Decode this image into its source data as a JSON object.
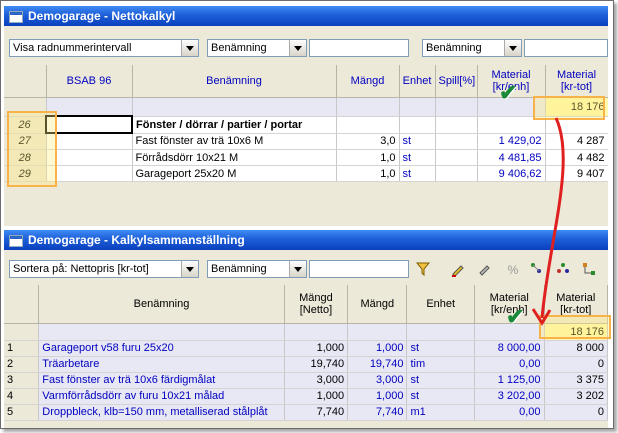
{
  "window1": {
    "title": "Demogarage - Nettokalkyl",
    "toolbar": {
      "filter": "Visa radnummerintervall",
      "sort1": "Benämning",
      "search1": "",
      "sort2": "Benämning",
      "search2": ""
    },
    "columns": {
      "bsab": "BSAB 96",
      "name": "Benämning",
      "qty": "Mängd",
      "unit": "Enhet",
      "waste": "Spill[%]",
      "mat_unit": "Material [kr/enh]",
      "mat_tot": "Material [kr-tot]"
    },
    "total": "18 176",
    "rows": [
      {
        "idx": "26",
        "bsab": "",
        "name": "Fönster / dörrar / partier / portar",
        "qty": "",
        "unit": "",
        "waste": "",
        "mat_unit": "",
        "mat_tot": ""
      },
      {
        "idx": "27",
        "bsab": "",
        "name": "Fast fönster av trä 10x6 M",
        "qty": "3,0",
        "unit": "st",
        "waste": "",
        "mat_unit": "1 429,02",
        "mat_tot": "4 287"
      },
      {
        "idx": "28",
        "bsab": "",
        "name": "Förrådsdörr 10x21 M",
        "qty": "1,0",
        "unit": "st",
        "waste": "",
        "mat_unit": "4 481,85",
        "mat_tot": "4 482"
      },
      {
        "idx": "29",
        "bsab": "",
        "name": "Garageport 25x20 M",
        "qty": "1,0",
        "unit": "st",
        "waste": "",
        "mat_unit": "9 406,62",
        "mat_tot": "9 407"
      }
    ]
  },
  "window2": {
    "title": "Demogarage - Kalkylsammanställning",
    "toolbar": {
      "sort": "Sortera på: Nettopris [kr-tot]",
      "sort2": "Benämning",
      "search": ""
    },
    "columns": {
      "name": "Benämning",
      "qty_net": "Mängd [Netto]",
      "qty": "Mängd",
      "unit": "Enhet",
      "mat_unit": "Material [kr/enh]",
      "mat_tot": "Material [kr-tot]"
    },
    "total": "18 176",
    "rows": [
      {
        "idx": "1",
        "name": "Garageport v58 furu 25x20",
        "qty_net": "1,000",
        "qty": "1,000",
        "unit": "st",
        "mat_unit": "8 000,00",
        "mat_tot": "8 000"
      },
      {
        "idx": "2",
        "name": "Träarbetare",
        "qty_net": "19,740",
        "qty": "19,740",
        "unit": "tim",
        "mat_unit": "0,00",
        "mat_tot": "0"
      },
      {
        "idx": "3",
        "name": "Fast fönster av trä 10x6 färdigmålat",
        "qty_net": "3,000",
        "qty": "3,000",
        "unit": "st",
        "mat_unit": "1 125,00",
        "mat_tot": "3 375"
      },
      {
        "idx": "4",
        "name": "Varmförrådsdörr av furu 10x21 målad",
        "qty_net": "1,000",
        "qty": "1,000",
        "unit": "st",
        "mat_unit": "3 202,00",
        "mat_tot": "3 202"
      },
      {
        "idx": "5",
        "name": "Droppbleck, klb=150 mm, metalliserad stålplåt",
        "qty_net": "7,740",
        "qty": "7,740",
        "unit": "m1",
        "mat_unit": "0,00",
        "mat_tot": "0"
      }
    ]
  },
  "colors": {
    "titlebar": "#1e5fd8",
    "highlight": "#f7b24a",
    "arrow": "#e02020",
    "check": "#1a8a3a"
  }
}
